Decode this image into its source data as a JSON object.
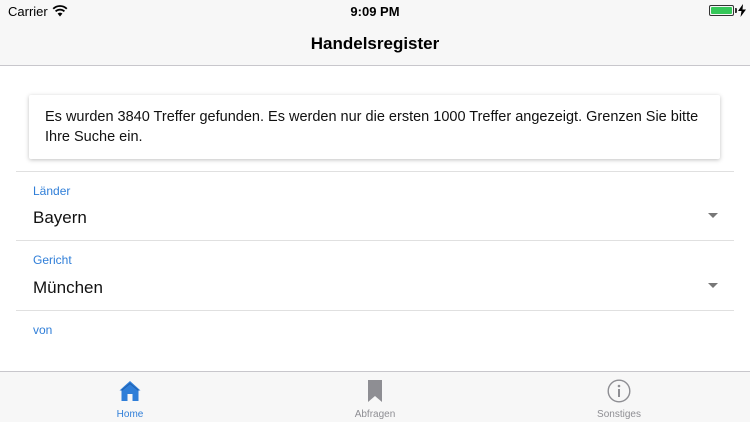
{
  "status_bar": {
    "carrier": "Carrier",
    "time": "9:09 PM",
    "battery_level": 1.0,
    "icons": [
      "wifi-icon",
      "battery-icon",
      "charging-icon"
    ]
  },
  "nav": {
    "title": "Handelsregister"
  },
  "info": {
    "message": "Es wurden 3840 Treffer gefunden. Es werden nur die ersten 1000 Treffer angezeigt. Grenzen Sie bitte Ihre Suche ein."
  },
  "form": {
    "laender": {
      "label": "Länder",
      "value": "Bayern"
    },
    "gericht": {
      "label": "Gericht",
      "value": "München"
    },
    "von": {
      "label": "von"
    }
  },
  "tabs": [
    {
      "label": "Home",
      "icon": "home-icon",
      "active": true
    },
    {
      "label": "Abfragen",
      "icon": "bookmark-icon",
      "active": false
    },
    {
      "label": "Sonstiges",
      "icon": "info-icon",
      "active": false
    }
  ],
  "colors": {
    "accent": "#2f7ed8",
    "inactive": "#8e8e93",
    "battery": "#35c759"
  }
}
